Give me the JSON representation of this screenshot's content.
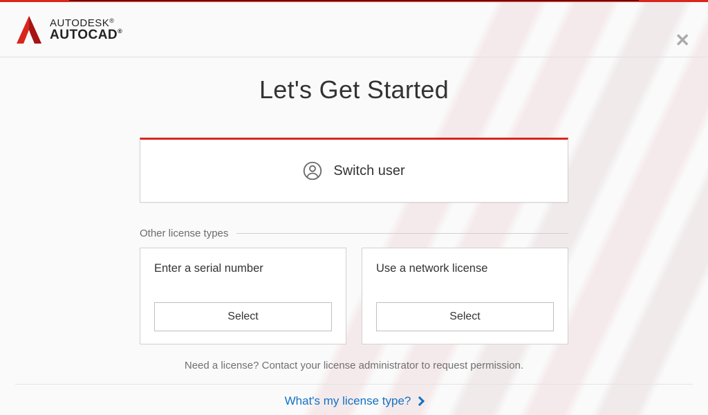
{
  "brand": {
    "line1": "AUTODESK",
    "line2": "AUTOCAD",
    "registered": "®"
  },
  "title": "Let's Get Started",
  "switch_user_label": "Switch user",
  "other_section_label": "Other license types",
  "options": [
    {
      "title": "Enter a serial number",
      "button": "Select"
    },
    {
      "title": "Use a network license",
      "button": "Select"
    }
  ],
  "need_license_text": "Need a license? Contact your license administrator to request permission.",
  "help_link_text": "What's my license type?",
  "colors": {
    "accent": "#d9261c",
    "link": "#1272c4"
  }
}
